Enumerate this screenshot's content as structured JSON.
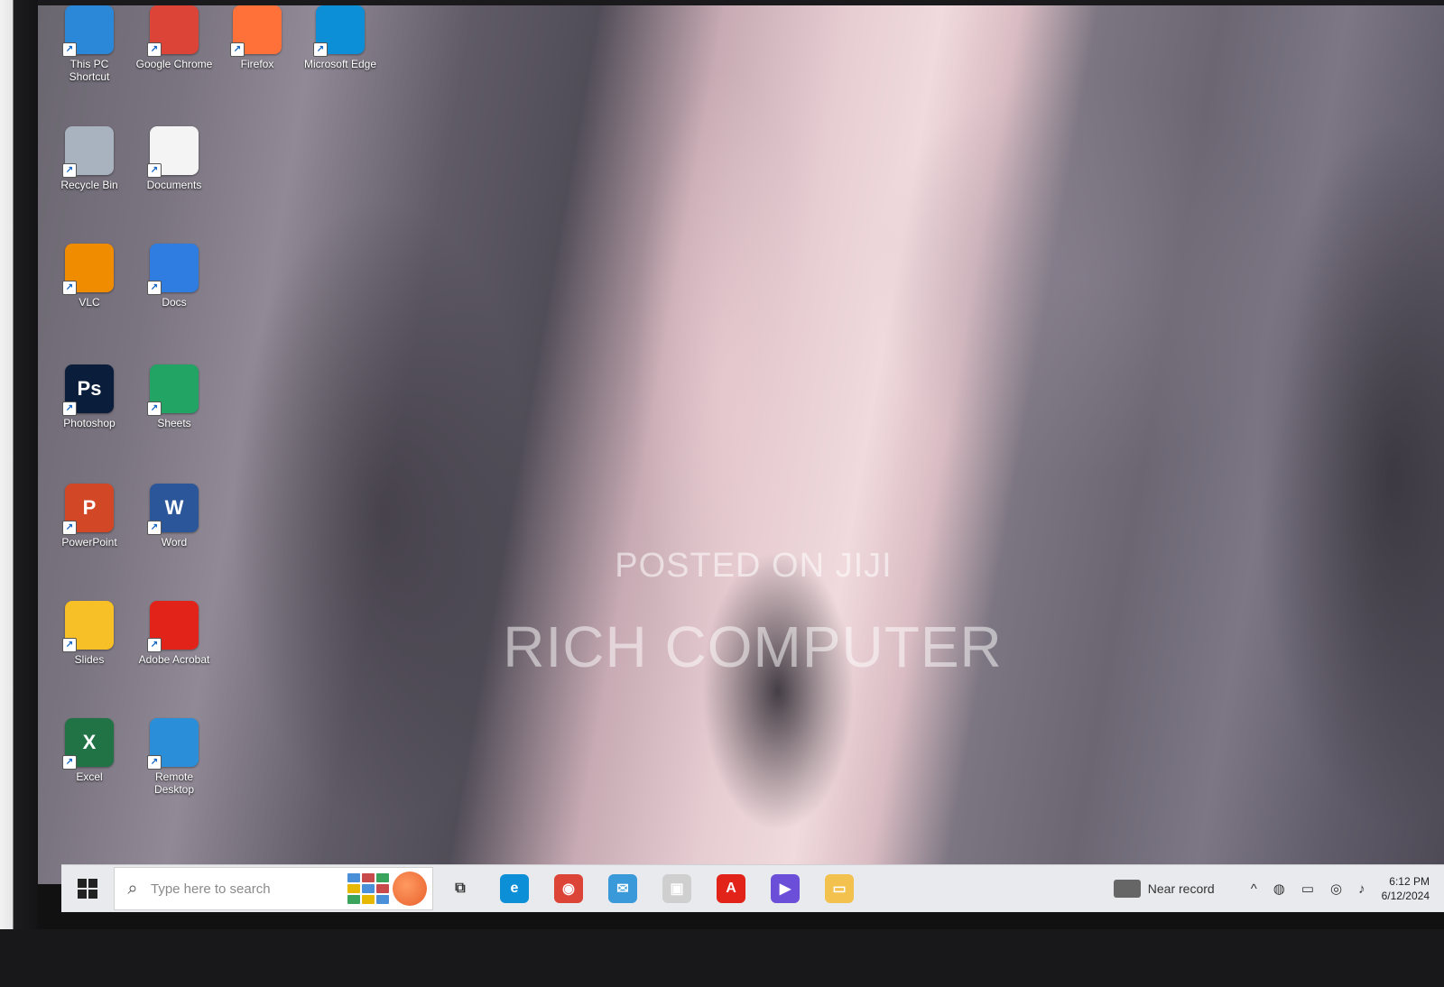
{
  "desktop": {
    "icons": [
      {
        "label": "This PC Shortcut",
        "glyph": "monitor-icon",
        "color": "#2b88d8"
      },
      {
        "label": "Google Chrome",
        "glyph": "chrome-icon",
        "color": "#db4437"
      },
      {
        "label": "Firefox",
        "glyph": "firefox-icon",
        "color": "#ff7139"
      },
      {
        "label": "Microsoft Edge",
        "glyph": "edge-icon",
        "color": "#0c8fd6"
      },
      {
        "label": "Recycle Bin",
        "glyph": "recycle-bin-icon",
        "color": "#a9b3bf"
      },
      {
        "label": "Documents",
        "glyph": "document-icon",
        "color": "#f4f4f4"
      },
      {
        "label": "VLC",
        "glyph": "vlc-icon",
        "color": "#f08c00"
      },
      {
        "label": "Docs",
        "glyph": "docs-icon",
        "color": "#2f7de1"
      },
      {
        "label": "Photoshop",
        "glyph": "photoshop-icon",
        "text": "Ps",
        "color": "#0a1e3c"
      },
      {
        "label": "Sheets",
        "glyph": "sheets-icon",
        "color": "#21a464"
      },
      {
        "label": "PowerPoint",
        "glyph": "powerpoint-icon",
        "text": "P",
        "color": "#d24726"
      },
      {
        "label": "Word",
        "glyph": "word-icon",
        "text": "W",
        "color": "#2b579a"
      },
      {
        "label": "Slides",
        "glyph": "slides-icon",
        "color": "#f6c026"
      },
      {
        "label": "Adobe Acrobat",
        "glyph": "acrobat-icon",
        "color": "#e2231a"
      },
      {
        "label": "Excel",
        "glyph": "excel-icon",
        "text": "X",
        "color": "#217346"
      },
      {
        "label": "Remote Desktop",
        "glyph": "remote-desktop-icon",
        "color": "#2a8fd8"
      }
    ],
    "watermark_line1": "POSTED ON JIJI",
    "watermark_line2": "RICH COMPUTER"
  },
  "taskbar": {
    "search_placeholder": "Type here to search",
    "apps": [
      {
        "name": "task-view-icon",
        "text": "⧉",
        "color": "#333333"
      },
      {
        "name": "edge-icon",
        "text": "e",
        "color": "#0c8fd6"
      },
      {
        "name": "chrome-icon",
        "text": "◉",
        "color": "#db4437"
      },
      {
        "name": "mail-icon",
        "text": "✉",
        "color": "#3a9ad9"
      },
      {
        "name": "store-icon",
        "text": "▣",
        "color": "#cfcfcf"
      },
      {
        "name": "acrobat-icon",
        "text": "A",
        "color": "#e2231a"
      },
      {
        "name": "media-player-icon",
        "text": "▶",
        "color": "#6b4fd8"
      },
      {
        "name": "file-explorer-icon",
        "text": "▭",
        "color": "#f2c14e"
      }
    ],
    "weather_text": "Near record",
    "tray_icons": [
      "^",
      "◍",
      "▭",
      "◎",
      "♪"
    ],
    "time": "6:12 PM",
    "date": "6/12/2024"
  }
}
